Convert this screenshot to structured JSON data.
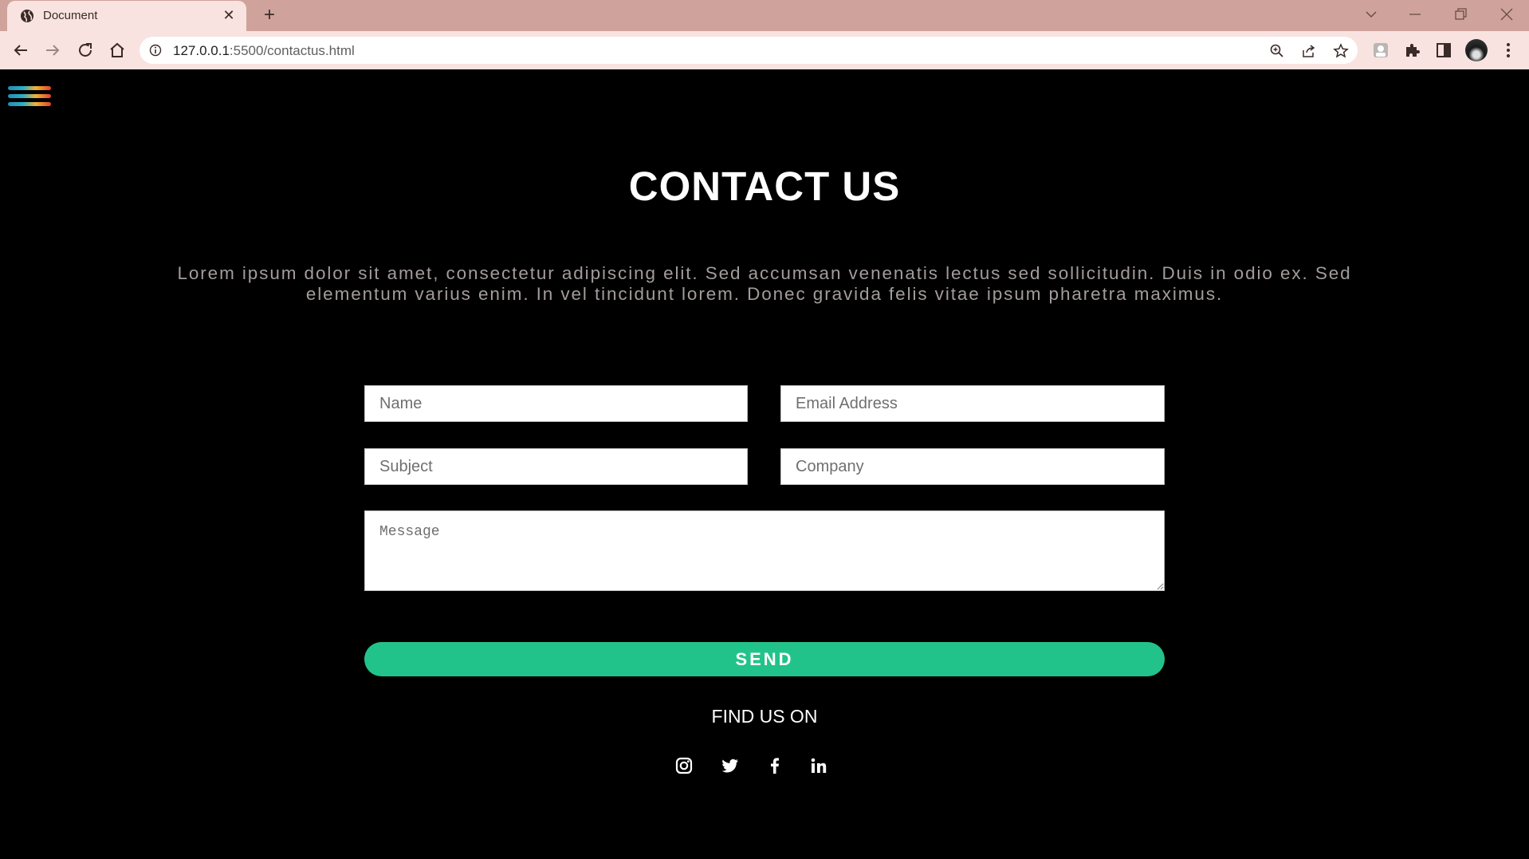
{
  "browser": {
    "tab_title": "Document",
    "tab_close": "✕",
    "new_tab": "+",
    "url_host": "127.0.0.1",
    "url_path": ":5500/contactus.html"
  },
  "page": {
    "title": "CONTACT US",
    "intro": "Lorem ipsum dolor sit amet, consectetur adipiscing elit. Sed accumsan venenatis lectus sed sollicitudin. Duis in odio ex. Sed elementum varius enim. In vel tincidunt lorem. Donec gravida felis vitae ipsum pharetra maximus.",
    "form": {
      "name_placeholder": "Name",
      "email_placeholder": "Email Address",
      "subject_placeholder": "Subject",
      "company_placeholder": "Company",
      "message_placeholder": "Message",
      "send_label": "SEND"
    },
    "find_us": "FIND US ON",
    "social_icons": [
      "instagram-icon",
      "twitter-icon",
      "facebook-icon",
      "linkedin-icon"
    ]
  },
  "colors": {
    "tab_strip": "#cfa39b",
    "toolbar": "#f8e3e0",
    "page_background": "#000000",
    "send_button": "#22c38b",
    "intro_text": "#a39c9b"
  }
}
